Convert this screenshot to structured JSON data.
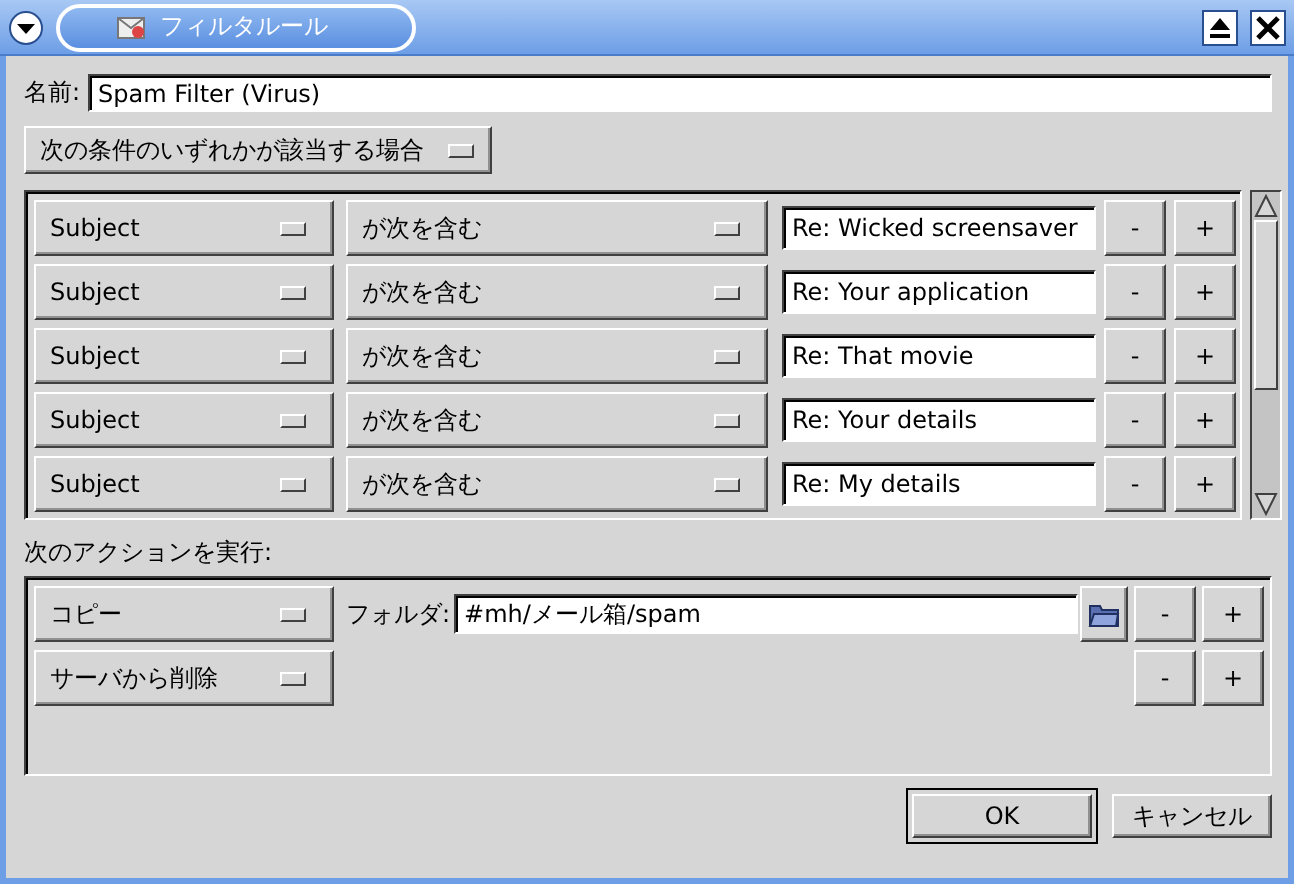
{
  "window": {
    "title": "フィルタルール"
  },
  "name": {
    "label": "名前:",
    "value": "Spam Filter (Virus)"
  },
  "match_mode": "次の条件のいずれかが該当する場合",
  "conditions": [
    {
      "field": "Subject",
      "operator": "が次を含む",
      "value": "Re: Wicked screensaver",
      "remove": "-",
      "add": "+"
    },
    {
      "field": "Subject",
      "operator": "が次を含む",
      "value": "Re: Your application",
      "remove": "-",
      "add": "+"
    },
    {
      "field": "Subject",
      "operator": "が次を含む",
      "value": "Re: That movie",
      "remove": "-",
      "add": "+"
    },
    {
      "field": "Subject",
      "operator": "が次を含む",
      "value": "Re: Your details",
      "remove": "-",
      "add": "+"
    },
    {
      "field": "Subject",
      "operator": "が次を含む",
      "value": "Re: My details",
      "remove": "-",
      "add": "+"
    }
  ],
  "actions_label": "次のアクションを実行:",
  "actions": [
    {
      "kind": "folder",
      "action": "コピー",
      "folder_label": "フォルダ:",
      "folder": "#mh/メール箱/spam",
      "remove": "-",
      "add": "+"
    },
    {
      "kind": "plain",
      "action": "サーバから削除",
      "remove": "-",
      "add": "+"
    }
  ],
  "buttons": [
    {
      "label": "OK",
      "default": true
    },
    {
      "label": "キャンセル",
      "default": false
    }
  ]
}
